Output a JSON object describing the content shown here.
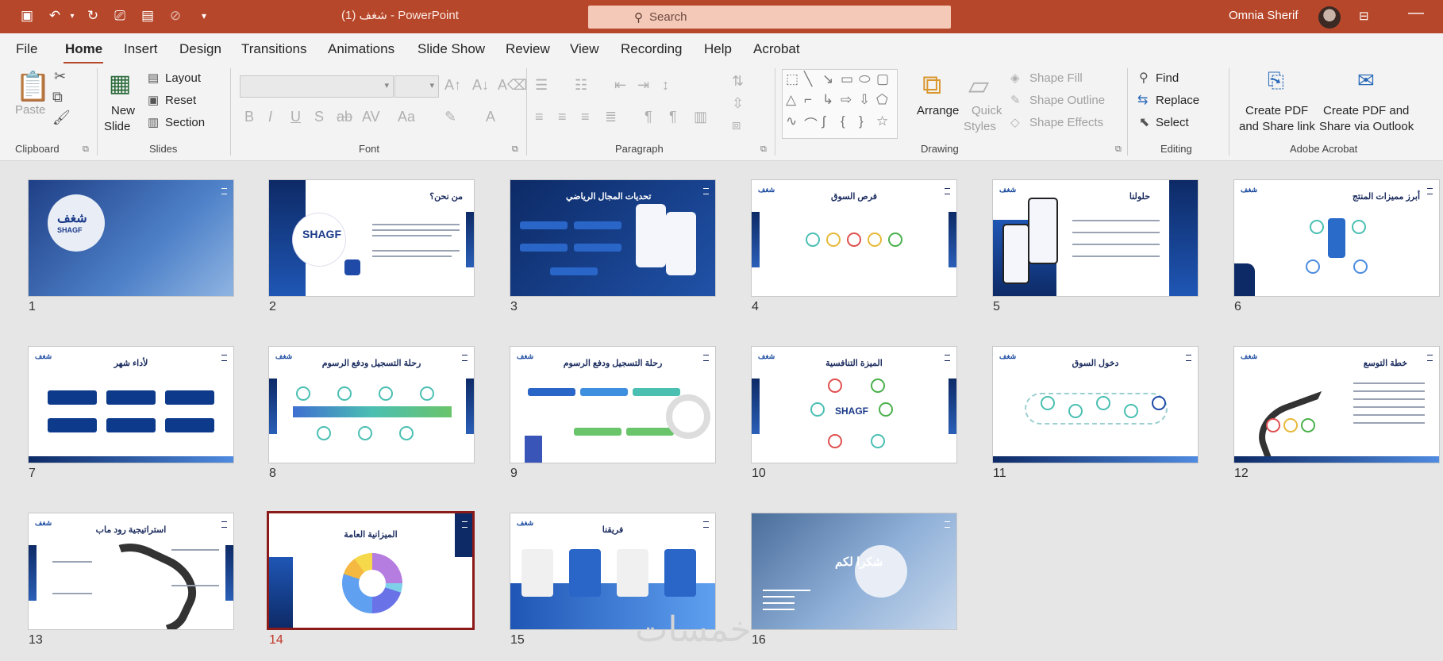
{
  "app": {
    "doc_name": "شغف (1)",
    "separator": " - ",
    "app_name": "PowerPoint",
    "search_placeholder": "Search",
    "user_name": "Omnia Sherif"
  },
  "tabs": [
    "File",
    "Home",
    "Insert",
    "Design",
    "Transitions",
    "Animations",
    "Slide Show",
    "Review",
    "View",
    "Recording",
    "Help",
    "Acrobat"
  ],
  "ribbon": {
    "clipboard": {
      "paste": "Paste",
      "label": "Clipboard"
    },
    "slides": {
      "new_slide_1": "New",
      "new_slide_2": "Slide",
      "layout": "Layout",
      "reset": "Reset",
      "section": "Section",
      "label": "Slides"
    },
    "font": {
      "label": "Font"
    },
    "paragraph": {
      "label": "Paragraph"
    },
    "drawing": {
      "arrange": "Arrange",
      "quick_styles_1": "Quick",
      "quick_styles_2": "Styles",
      "shape_fill": "Shape Fill",
      "shape_outline": "Shape Outline",
      "shape_effects": "Shape Effects",
      "label": "Drawing"
    },
    "editing": {
      "find": "Find",
      "replace": "Replace",
      "select": "Select",
      "label": "Editing"
    },
    "acrobat": {
      "create_pdf_1": "Create PDF",
      "create_pdf_2": "and Share link",
      "create_pdf_outlook_1": "Create PDF and",
      "create_pdf_outlook_2": "Share via Outlook",
      "label": "Adobe Acrobat"
    }
  },
  "slides": [
    {
      "num": "1",
      "title": "شغف",
      "sub": "SHAGF"
    },
    {
      "num": "2",
      "title": "من نحن؟",
      "sub": "SHAGF"
    },
    {
      "num": "3",
      "title": "تحديات المجال الرياضي"
    },
    {
      "num": "4",
      "title": "فرص السوق"
    },
    {
      "num": "5",
      "title": "حلولنا"
    },
    {
      "num": "6",
      "title": "أبرز مميزات المنتج"
    },
    {
      "num": "7",
      "title": "لأداء شهر"
    },
    {
      "num": "8",
      "title": "رحلة التسجيل ودفع الرسوم"
    },
    {
      "num": "9",
      "title": "رحلة التسجيل ودفع الرسوم"
    },
    {
      "num": "10",
      "title": "الميزة التنافسية",
      "sub": "SHAGF"
    },
    {
      "num": "11",
      "title": "دخول السوق"
    },
    {
      "num": "12",
      "title": "خطة التوسع"
    },
    {
      "num": "13",
      "title": "استراتيجية رود ماب"
    },
    {
      "num": "14",
      "title": "الميزانية العامة",
      "center_text": "الميزانية العامة"
    },
    {
      "num": "15",
      "title": "فريقنا"
    },
    {
      "num": "16",
      "title": "شكرا لكم"
    }
  ],
  "selected_slide": "14",
  "watermark": "خمسات",
  "colors": {
    "accent": "#b7472a",
    "navy": "#0d2a66",
    "selection": "#8b1a1a"
  }
}
